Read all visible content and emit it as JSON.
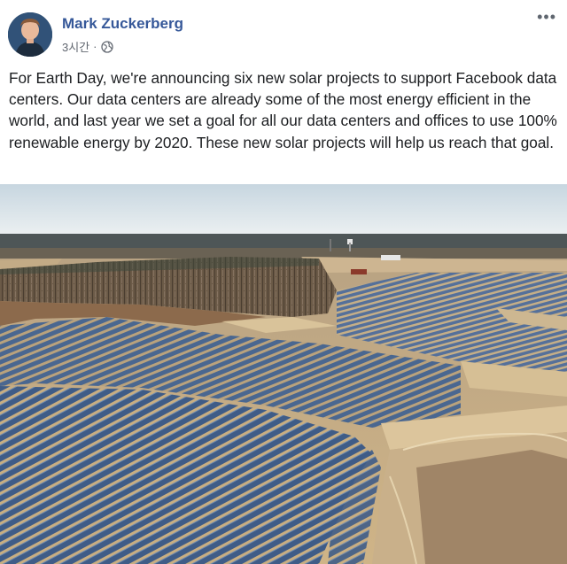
{
  "post": {
    "author": "Mark Zuckerberg",
    "timestamp": "3시간",
    "separator": "·",
    "privacy_icon": "globe-icon",
    "more_icon": "more-options-icon",
    "more_label": "•••",
    "text": "For Earth Day, we're announcing six new solar projects to support Facebook data centers. Our data centers are already some of the most energy efficient in the world, and last year we set a goal for all our data centers and offices to use 100% renewable energy by 2020. These new solar projects will help us reach that goal."
  },
  "colors": {
    "author_link": "#365899",
    "meta_text": "#616770",
    "panel_blue": "#3d5a85",
    "sand": "#d8c197",
    "forest": "#5e4f3d",
    "sky": "#dfe9ef"
  }
}
